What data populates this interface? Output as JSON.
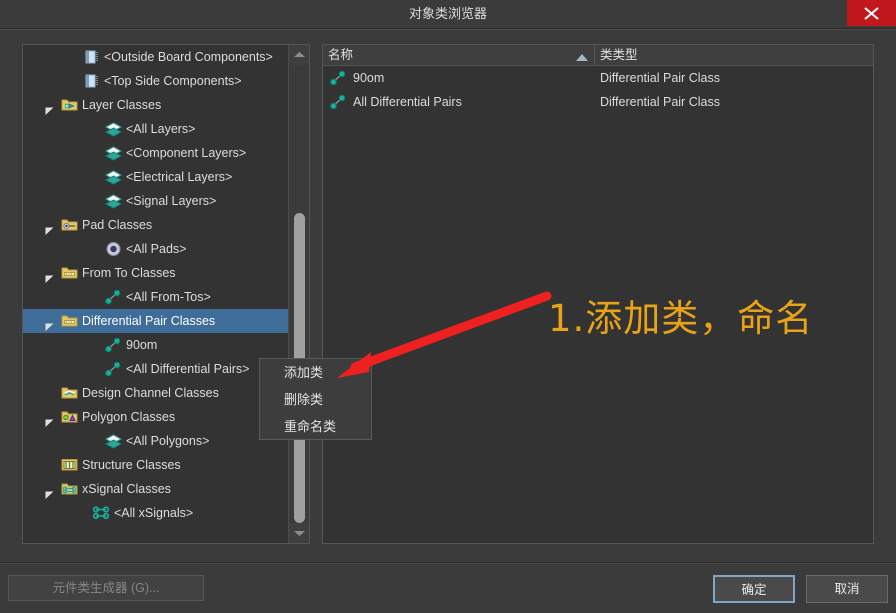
{
  "window": {
    "title": "对象类浏览器",
    "close_label": "×",
    "close_color": "#c0181c"
  },
  "tree": {
    "items": [
      {
        "label": "<Outside Board Components>",
        "indent": 68,
        "icon": "component-layer-icon",
        "expander": "none"
      },
      {
        "label": "<Top Side Components>",
        "indent": 68,
        "icon": "component-layer-icon",
        "expander": "none"
      },
      {
        "label": "Layer Classes",
        "indent": 46,
        "icon": "folder-layer-icon",
        "expander": "expanded"
      },
      {
        "label": "<All Layers>",
        "indent": 90,
        "icon": "layers-icon",
        "expander": "none"
      },
      {
        "label": "<Component Layers>",
        "indent": 90,
        "icon": "layers-icon",
        "expander": "none"
      },
      {
        "label": "<Electrical Layers>",
        "indent": 90,
        "icon": "layers-icon",
        "expander": "none"
      },
      {
        "label": "<Signal Layers>",
        "indent": 90,
        "icon": "layers-icon",
        "expander": "none"
      },
      {
        "label": "Pad Classes",
        "indent": 46,
        "icon": "folder-pad-icon",
        "expander": "expanded"
      },
      {
        "label": "<All Pads>",
        "indent": 90,
        "icon": "pad-icon",
        "expander": "none"
      },
      {
        "label": "From To Classes",
        "indent": 46,
        "icon": "folder-fromto-icon",
        "expander": "expanded"
      },
      {
        "label": "<All From-Tos>",
        "indent": 90,
        "icon": "fromto-icon",
        "expander": "none"
      },
      {
        "label": "Differential Pair Classes",
        "indent": 46,
        "icon": "folder-diffpair-icon",
        "expander": "expanded",
        "selected": true
      },
      {
        "label": "90om",
        "indent": 90,
        "icon": "diffpair-icon",
        "expander": "none"
      },
      {
        "label": "<All Differential Pairs>",
        "indent": 90,
        "icon": "diffpair-icon",
        "expander": "none"
      },
      {
        "label": "Design Channel Classes",
        "indent": 46,
        "icon": "folder-channel-icon",
        "expander": "none"
      },
      {
        "label": "Polygon Classes",
        "indent": 46,
        "icon": "folder-polygon-icon",
        "expander": "expanded"
      },
      {
        "label": "<All Polygons>",
        "indent": 90,
        "icon": "layers-icon",
        "expander": "none"
      },
      {
        "label": "Structure Classes",
        "indent": 46,
        "icon": "folder-structure-icon",
        "expander": "none"
      },
      {
        "label": "xSignal Classes",
        "indent": 46,
        "icon": "folder-xsignal-icon",
        "expander": "expanded"
      },
      {
        "label": "<All xSignals>",
        "indent": 78,
        "icon": "xsignal-icon",
        "expander": "none"
      }
    ],
    "selection_color": "#3f6d99"
  },
  "list": {
    "columns": [
      "名称",
      "类类型"
    ],
    "sort_column": "名称",
    "sort_direction": "asc",
    "rows": [
      {
        "name": "90om",
        "type": "Differential Pair Class",
        "icon": "diffpair-icon"
      },
      {
        "name": "All Differential Pairs",
        "type": "Differential Pair Class",
        "icon": "diffpair-icon"
      }
    ]
  },
  "context_menu": {
    "items": [
      "添加类",
      "删除类",
      "重命名类"
    ]
  },
  "annotation": {
    "text": "1.添加类，命名",
    "color": "#e8a317",
    "arrow_color": "#ee2020"
  },
  "footer": {
    "generator_button": "元件类生成器 (G)...",
    "ok_button": "确定",
    "cancel_button": "取消"
  }
}
